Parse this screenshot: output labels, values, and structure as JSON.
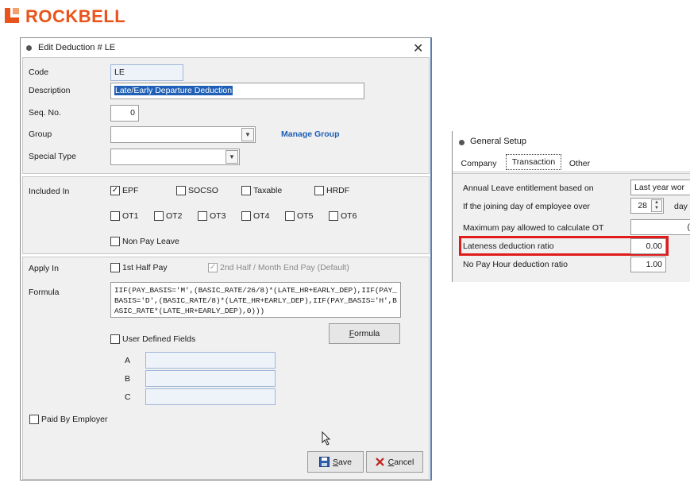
{
  "logo": {
    "text": "ROCKBELL"
  },
  "dialog": {
    "title": "Edit Deduction # LE",
    "close": "✕",
    "fields": {
      "code_label": "Code",
      "code_value": "LE",
      "description_label": "Description",
      "description_value": "Late/Early Departure Deduction",
      "seq_label": "Seq. No.",
      "seq_value": "0",
      "group_label": "Group",
      "group_value": "",
      "manage_group": "Manage Group",
      "special_type_label": "Special Type",
      "special_type_value": ""
    },
    "included": {
      "label": "Included In",
      "items": [
        {
          "label": "EPF",
          "checked": true
        },
        {
          "label": "SOCSO",
          "checked": false
        },
        {
          "label": "Taxable",
          "checked": false
        },
        {
          "label": "HRDF",
          "checked": false
        },
        {
          "label": "OT1",
          "checked": false
        },
        {
          "label": "OT2",
          "checked": false
        },
        {
          "label": "OT3",
          "checked": false
        },
        {
          "label": "OT4",
          "checked": false
        },
        {
          "label": "OT5",
          "checked": false
        },
        {
          "label": "OT6",
          "checked": false
        },
        {
          "label": "Non Pay Leave",
          "checked": false
        }
      ]
    },
    "apply": {
      "label": "Apply In",
      "first_half": "1st Half Pay",
      "second_half": "2nd Half / Month End Pay (Default)",
      "formula_label": "Formula",
      "formula_value": "IIF(PAY_BASIS='M',(BASIC_RATE/26/8)*(LATE_HR+EARLY_DEP),IIF(PAY_BASIS='D',(BASIC_RATE/8)*(LATE_HR+EARLY_DEP),IIF(PAY_BASIS='H',BASIC_RATE*(LATE_HR+EARLY_DEP),0)))",
      "formula_btn_u": "F",
      "formula_btn_rest": "ormula",
      "user_defined": "User Defined Fields",
      "ud_a": "A",
      "ud_b": "B",
      "ud_c": "C",
      "paid_by_employer": "Paid By Employer"
    },
    "buttons": {
      "save_u": "S",
      "save_rest": "ave",
      "cancel_u": "C",
      "cancel_rest": "ancel"
    }
  },
  "general_setup": {
    "title": "General Setup",
    "tabs": [
      {
        "label": "Company",
        "active": false
      },
      {
        "label": "Transaction",
        "active": true
      },
      {
        "label": "Other",
        "active": false
      }
    ],
    "rows": {
      "annual_leave_label": "Annual Leave entitlement based on",
      "annual_leave_value": "Last year wor",
      "joining_label": "If the joining day of employee over",
      "joining_value": "28",
      "joining_suffix": "day",
      "max_pay_label": "Maximum pay allowed to calculate OT",
      "max_pay_value": "(",
      "lateness_label": "Lateness deduction ratio",
      "lateness_value": "0.00",
      "no_pay_label": "No Pay Hour deduction ratio",
      "no_pay_value": "1.00"
    }
  },
  "colors": {
    "brand": "#e8541a",
    "link": "#1f5fb5",
    "highlight": "#e01b1b",
    "selection": "#1f5fb5"
  },
  "icons": {
    "save": "floppy-disk-icon",
    "cancel": "x-mark-icon",
    "cursor": "mouse-pointer-icon"
  }
}
